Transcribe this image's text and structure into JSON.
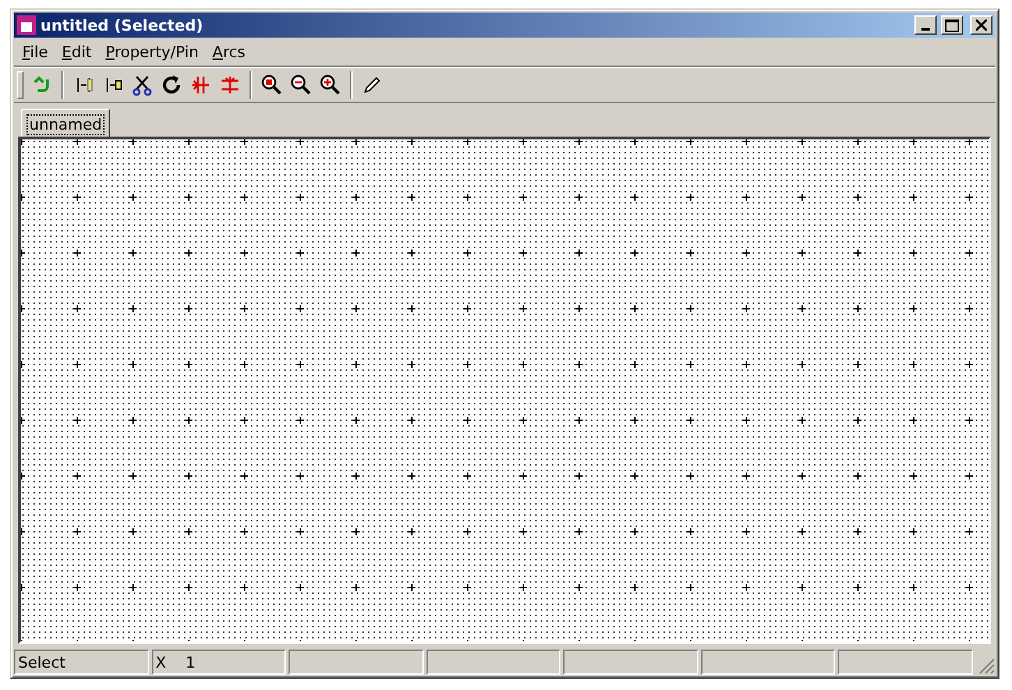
{
  "window": {
    "title": "untitled (Selected)"
  },
  "menu": [
    {
      "label": "File"
    },
    {
      "label": "Edit"
    },
    {
      "label": "Property/Pin"
    },
    {
      "label": "Arcs"
    }
  ],
  "tabs": [
    {
      "label": "unnamed",
      "selected": true
    }
  ],
  "status_bar": [
    {
      "text": "Select"
    },
    {
      "text": "X",
      "value": "1"
    }
  ]
}
